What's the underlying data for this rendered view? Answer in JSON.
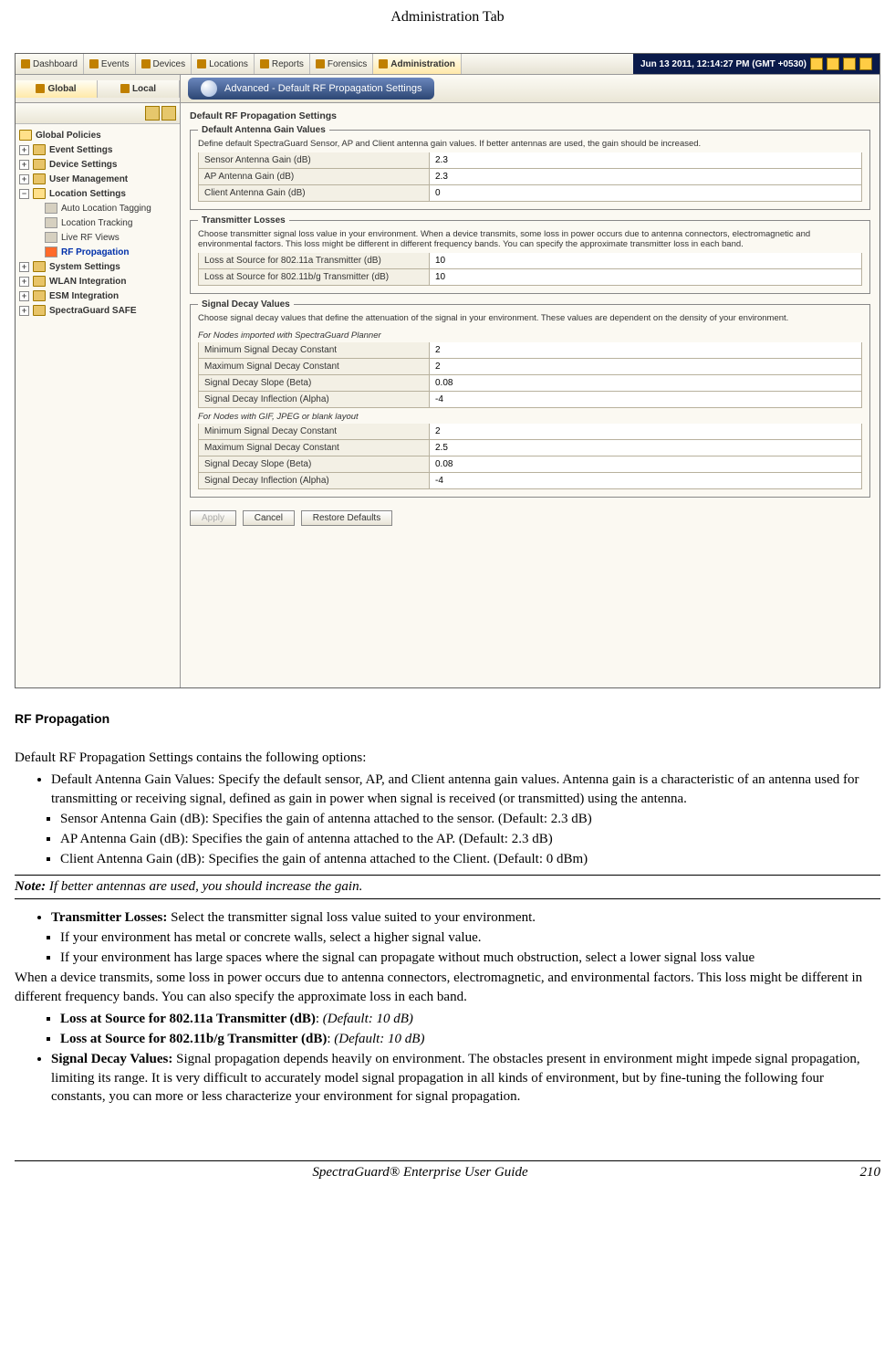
{
  "header_title": "Administration Tab",
  "tabs": [
    "Dashboard",
    "Events",
    "Devices",
    "Locations",
    "Reports",
    "Forensics",
    "Administration"
  ],
  "active_tab_index": 6,
  "datetime": "Jun 13 2011, 12:14:27 PM (GMT +0530)",
  "subbar": {
    "global": "Global",
    "local": "Local"
  },
  "banner": "Advanced - Default RF Propagation Settings",
  "sidebar": {
    "header": "Global Policies",
    "items": [
      {
        "label": "Event Settings",
        "expandable": true
      },
      {
        "label": "Device Settings",
        "expandable": true
      },
      {
        "label": "User Management",
        "expandable": true
      },
      {
        "label": "Location Settings",
        "expandable": true,
        "open": true,
        "children": [
          {
            "label": "Auto Location Tagging"
          },
          {
            "label": "Location Tracking"
          },
          {
            "label": "Live RF Views"
          },
          {
            "label": "RF Propagation",
            "selected": true
          }
        ]
      },
      {
        "label": "System Settings",
        "expandable": true
      },
      {
        "label": "WLAN Integration",
        "expandable": true
      },
      {
        "label": "ESM Integration",
        "expandable": true
      },
      {
        "label": "SpectraGuard SAFE",
        "expandable": true
      }
    ]
  },
  "panel": {
    "title": "Default RF Propagation Settings",
    "antenna": {
      "legend": "Default Antenna Gain Values",
      "desc": "Define default SpectraGuard Sensor, AP and Client antenna gain values. If better antennas are used, the gain should be increased.",
      "rows": [
        {
          "label": "Sensor Antenna Gain (dB)",
          "value": "2.3"
        },
        {
          "label": "AP Antenna Gain (dB)",
          "value": "2.3"
        },
        {
          "label": "Client Antenna Gain (dB)",
          "value": "0"
        }
      ]
    },
    "transmitter": {
      "legend": "Transmitter Losses",
      "desc": "Choose transmitter signal loss value in your environment. When a device transmits, some loss in power occurs due to antenna connectors, electromagnetic and environmental factors. This loss might be different in different frequency bands. You can specify the approximate transmitter loss in each band.",
      "rows": [
        {
          "label": "Loss at Source for 802.11a Transmitter (dB)",
          "value": "10"
        },
        {
          "label": "Loss at Source for 802.11b/g Transmitter (dB)",
          "value": "10"
        }
      ]
    },
    "decay": {
      "legend": "Signal Decay Values",
      "desc": "Choose signal decay values that define the attenuation of the signal in your environment. These values are dependent on the density of your environment.",
      "sub1": "For Nodes imported with SpectraGuard Planner",
      "rows1": [
        {
          "label": "Minimum Signal Decay Constant",
          "value": "2"
        },
        {
          "label": "Maximum Signal Decay Constant",
          "value": "2"
        },
        {
          "label": "Signal Decay Slope (Beta)",
          "value": "0.08"
        },
        {
          "label": "Signal Decay Inflection (Alpha)",
          "value": "-4"
        }
      ],
      "sub2": "For Nodes with GIF, JPEG or blank layout",
      "rows2": [
        {
          "label": "Minimum Signal Decay Constant",
          "value": "2"
        },
        {
          "label": "Maximum Signal Decay Constant",
          "value": "2.5"
        },
        {
          "label": "Signal Decay Slope (Beta)",
          "value": "0.08"
        },
        {
          "label": "Signal Decay Inflection (Alpha)",
          "value": "-4"
        }
      ]
    },
    "buttons": {
      "apply": "Apply",
      "cancel": "Cancel",
      "restore": "Restore Defaults"
    }
  },
  "doc": {
    "fig_caption": "RF Propagation",
    "intro": "Default RF Propagation Settings contains the following options:",
    "b1": "Default Antenna Gain Values: Specify the default sensor, AP, and Client antenna gain values. Antenna gain is a characteristic of an antenna used for transmitting or receiving signal, defined as gain in power when signal is received (or transmitted) using the antenna.",
    "b1s1": "Sensor Antenna Gain (dB): Specifies the gain of antenna attached to the sensor. (Default: 2.3 dB)",
    "b1s2": "AP Antenna Gain (dB): Specifies the gain of antenna attached to the AP. (Default: 2.3 dB)",
    "b1s3": "Client Antenna Gain (dB): Specifies the gain of antenna attached to the Client. (Default: 0 dBm)",
    "note_label": "Note:",
    "note_text": " If better antennas are used, you should increase the gain.",
    "b2_head": "Transmitter Losses:",
    "b2_tail": " Select the transmitter signal loss value suited to your environment.",
    "b2s1": "If your environment has metal or concrete walls, select a higher signal value.",
    "b2s2": "If your environment has large spaces where the signal can propagate without much obstruction, select a lower signal loss value",
    "b2_para": "When a device transmits, some loss in power occurs due to antenna connectors, electromagnetic, and environmental factors. This loss might be different in different frequency bands. You can also specify the approximate loss in each band.",
    "b2s3_head": "Loss at Source for 802.11a Transmitter (dB)",
    "b2s3_tail": ": ",
    "b2s3_def": "(Default: 10 dB)",
    "b2s4_head": "Loss at Source for 802.11b/g Transmitter (dB)",
    "b2s4_tail": ": ",
    "b2s4_def": "(Default: 10 dB)",
    "b3_head": "Signal Decay Values:",
    "b3_tail": " Signal propagation depends heavily on environment. The obstacles present in environment might impede signal propagation, limiting its range. It is very difficult to accurately model signal propagation in all kinds of environment, but by fine-tuning the following four constants, you can more or less characterize your environment for signal propagation."
  },
  "footer": {
    "title": "SpectraGuard®  Enterprise User Guide",
    "page": "210"
  }
}
